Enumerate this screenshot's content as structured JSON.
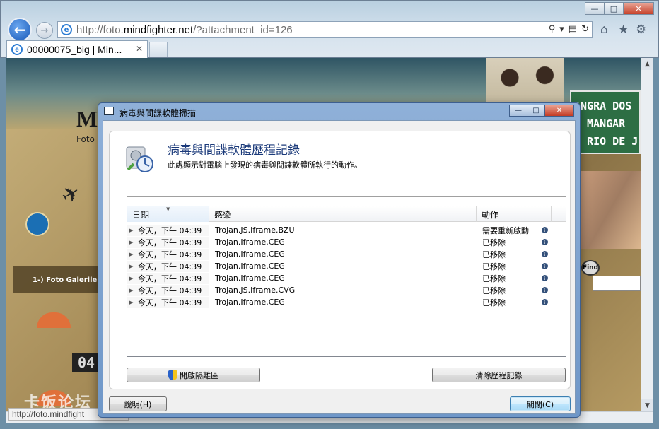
{
  "browser": {
    "url_domain_prefix": "http://foto.",
    "url_domain": "mindfighter.net",
    "url_path": "/?attachment_id=126",
    "tab_title": "00000075_big | Min...",
    "status_text": "http://foto.mindfight"
  },
  "website": {
    "brand_letter": "M",
    "brand_sub": "Foto",
    "nav_item": "1-) Foto Galeriler",
    "clock_digits": "04",
    "sign_lines": [
      "ANGRA DOS",
      "← MANGAR",
      "← RIO DE J"
    ],
    "find_label": "Find",
    "watermark": "卡饭论坛"
  },
  "dialog": {
    "window_title": "病毒與間諜軟體掃描",
    "heading": "病毒與間諜軟體歷程記錄",
    "description": "此處顯示對電腦上發現的病毒與間諜軟體所執行的動作。",
    "columns": [
      "日期",
      "感染",
      "動作"
    ],
    "rows": [
      {
        "date": "今天，下午 04:39",
        "infection": "Trojan.JS.Iframe.BZU",
        "action": "需要重新啟動"
      },
      {
        "date": "今天，下午 04:39",
        "infection": "Trojan.Iframe.CEG",
        "action": "已移除"
      },
      {
        "date": "今天，下午 04:39",
        "infection": "Trojan.Iframe.CEG",
        "action": "已移除"
      },
      {
        "date": "今天，下午 04:39",
        "infection": "Trojan.Iframe.CEG",
        "action": "已移除"
      },
      {
        "date": "今天，下午 04:39",
        "infection": "Trojan.Iframe.CEG",
        "action": "已移除"
      },
      {
        "date": "今天，下午 04:39",
        "infection": "Trojan.JS.Iframe.CVG",
        "action": "已移除"
      },
      {
        "date": "今天，下午 04:39",
        "infection": "Trojan.Iframe.CEG",
        "action": "已移除"
      }
    ],
    "open_quarantine_label": "開啟隔離區",
    "clear_history_label": "清除歷程記錄",
    "help_label": "說明(H)",
    "close_label": "關閉(C)"
  },
  "icons": {
    "back": "back-arrow-icon",
    "forward": "forward-arrow-icon",
    "info": "info-icon",
    "shield": "uac-shield-icon"
  },
  "colors": {
    "dialog_frame": "#8fb0d8",
    "heading": "#1b3a7a",
    "close_accent": "#c43c25"
  }
}
